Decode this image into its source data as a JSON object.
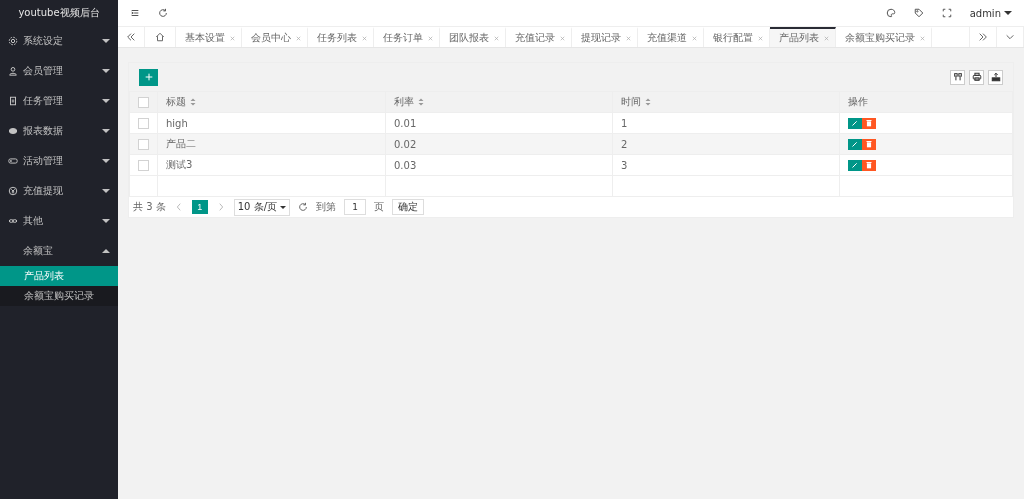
{
  "sidebar": {
    "title": "youtube视频后台",
    "items": [
      {
        "label": "系统设定",
        "expanded": false
      },
      {
        "label": "会员管理",
        "expanded": false
      },
      {
        "label": "任务管理",
        "expanded": false
      },
      {
        "label": "报表数据",
        "expanded": false
      },
      {
        "label": "活动管理",
        "expanded": false
      },
      {
        "label": "充值提现",
        "expanded": false
      },
      {
        "label": "其他",
        "expanded": false
      },
      {
        "label": "余额宝",
        "expanded": true,
        "children": [
          {
            "label": "产品列表",
            "selected": true
          },
          {
            "label": "余额宝购买记录",
            "selected": false
          }
        ]
      }
    ]
  },
  "header": {
    "user": "admin"
  },
  "tabs": [
    {
      "label": "基本设置",
      "selected": false
    },
    {
      "label": "会员中心",
      "selected": false
    },
    {
      "label": "任务列表",
      "selected": false
    },
    {
      "label": "任务订单",
      "selected": false
    },
    {
      "label": "团队报表",
      "selected": false
    },
    {
      "label": "充值记录",
      "selected": false
    },
    {
      "label": "提现记录",
      "selected": false
    },
    {
      "label": "充值渠道",
      "selected": false
    },
    {
      "label": "银行配置",
      "selected": false
    },
    {
      "label": "产品列表",
      "selected": true
    },
    {
      "label": "余额宝购买记录",
      "selected": false
    }
  ],
  "table": {
    "select_all": false,
    "columns": [
      "标题",
      "利率",
      "时间",
      "操作"
    ],
    "rows": [
      {
        "checked": false,
        "cells": [
          "high",
          "0.01",
          "1"
        ]
      },
      {
        "checked": false,
        "cells": [
          "产品二",
          "0.02",
          "2"
        ]
      },
      {
        "checked": false,
        "cells": [
          "测试3",
          "0.03",
          "3"
        ]
      }
    ]
  },
  "pagination": {
    "total": "共 3 条",
    "page": "1",
    "page_size": "10 条/页",
    "goto_label": "到第",
    "goto_value": "1",
    "page_unit": "页",
    "confirm": "确定"
  }
}
